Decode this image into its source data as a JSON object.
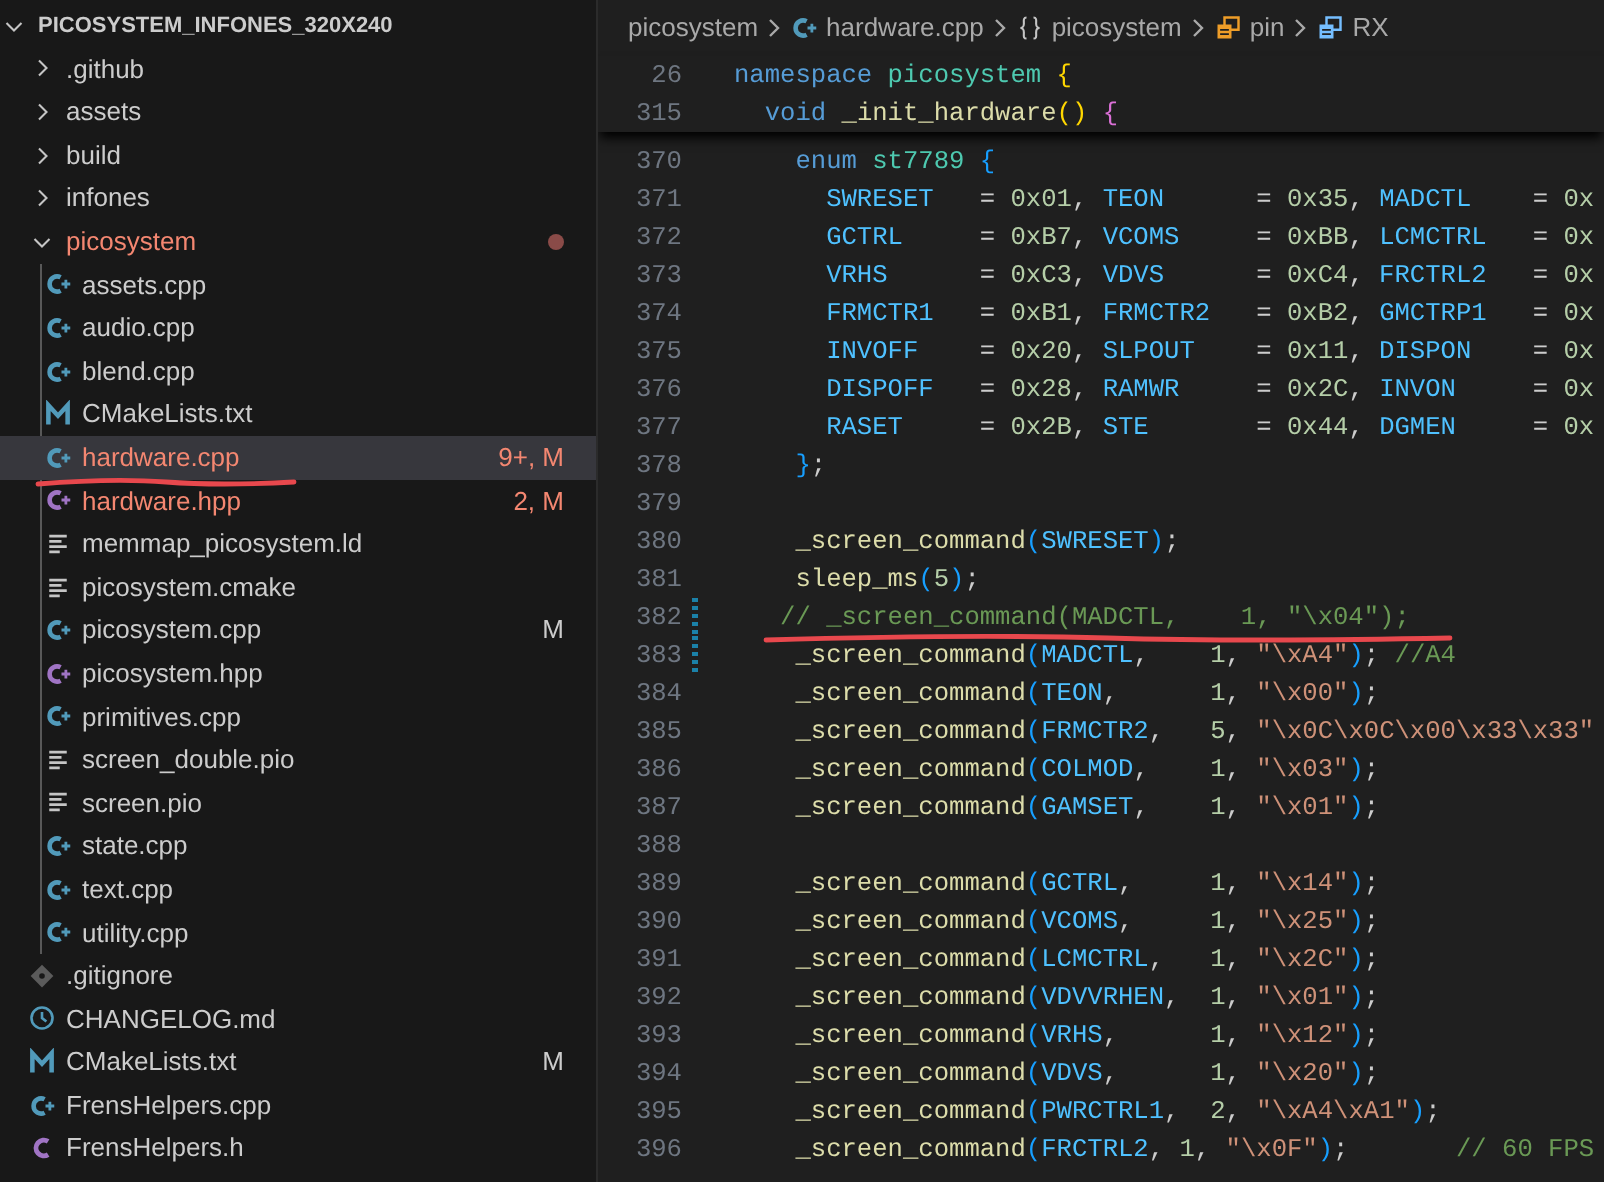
{
  "explorer": {
    "title": "PICOSYSTEM_INFONES_320X240",
    "expanded": true,
    "items": [
      {
        "label": ".github",
        "kind": "folder",
        "expanded": false,
        "selected": false,
        "error": false,
        "underlined": false
      },
      {
        "label": "assets",
        "kind": "folder",
        "expanded": false,
        "selected": false,
        "error": false,
        "underlined": false
      },
      {
        "label": "build",
        "kind": "folder",
        "expanded": false,
        "selected": false,
        "error": false,
        "underlined": false
      },
      {
        "label": "infones",
        "kind": "folder",
        "expanded": false,
        "selected": false,
        "error": false,
        "underlined": false
      },
      {
        "label": "picosystem",
        "kind": "folder",
        "expanded": true,
        "selected": false,
        "error": true,
        "underlined": false,
        "problem_dot": true,
        "children": [
          {
            "label": "assets.cpp",
            "kind": "cpp",
            "selected": false,
            "error": false,
            "underlined": false
          },
          {
            "label": "audio.cpp",
            "kind": "cpp",
            "selected": false,
            "error": false,
            "underlined": false
          },
          {
            "label": "blend.cpp",
            "kind": "cpp",
            "selected": false,
            "error": false,
            "underlined": false
          },
          {
            "label": "CMakeLists.txt",
            "kind": "cmake",
            "selected": false,
            "error": false,
            "underlined": false
          },
          {
            "label": "hardware.cpp",
            "kind": "cpp",
            "selected": true,
            "error": true,
            "underlined": true,
            "badge": "9+, M"
          },
          {
            "label": "hardware.hpp",
            "kind": "hpp",
            "selected": false,
            "error": true,
            "underlined": false,
            "badge": "2, M"
          },
          {
            "label": "memmap_picosystem.ld",
            "kind": "text",
            "selected": false,
            "error": false,
            "underlined": false
          },
          {
            "label": "picosystem.cmake",
            "kind": "text",
            "selected": false,
            "error": false,
            "underlined": false
          },
          {
            "label": "picosystem.cpp",
            "kind": "cpp",
            "selected": false,
            "error": false,
            "underlined": false,
            "badge": "M"
          },
          {
            "label": "picosystem.hpp",
            "kind": "hpp",
            "selected": false,
            "error": false,
            "underlined": false
          },
          {
            "label": "primitives.cpp",
            "kind": "cpp",
            "selected": false,
            "error": false,
            "underlined": false
          },
          {
            "label": "screen_double.pio",
            "kind": "text",
            "selected": false,
            "error": false,
            "underlined": false
          },
          {
            "label": "screen.pio",
            "kind": "text",
            "selected": false,
            "error": false,
            "underlined": false
          },
          {
            "label": "state.cpp",
            "kind": "cpp",
            "selected": false,
            "error": false,
            "underlined": false
          },
          {
            "label": "text.cpp",
            "kind": "cpp",
            "selected": false,
            "error": false,
            "underlined": false
          },
          {
            "label": "utility.cpp",
            "kind": "cpp",
            "selected": false,
            "error": false,
            "underlined": false
          }
        ]
      },
      {
        "label": ".gitignore",
        "kind": "git",
        "selected": false,
        "error": false,
        "underlined": false
      },
      {
        "label": "CHANGELOG.md",
        "kind": "changelog",
        "selected": false,
        "error": false,
        "underlined": false
      },
      {
        "label": "CMakeLists.txt",
        "kind": "cmake",
        "selected": false,
        "error": false,
        "underlined": false,
        "badge": "M"
      },
      {
        "label": "FrensHelpers.cpp",
        "kind": "cpp",
        "selected": false,
        "error": false,
        "underlined": false
      },
      {
        "label": "FrensHelpers.h",
        "kind": "h",
        "selected": false,
        "error": false,
        "underlined": false
      }
    ]
  },
  "breadcrumbs": [
    {
      "label": "picosystem",
      "kind": "path"
    },
    {
      "label": "hardware.cpp",
      "kind": "cpp"
    },
    {
      "label": "picosystem",
      "kind": "namespace"
    },
    {
      "label": "pin",
      "kind": "struct"
    },
    {
      "label": "RX",
      "kind": "field"
    }
  ],
  "sticky_lines": [
    {
      "number": "26",
      "tokens": [
        {
          "text": "namespace ",
          "kind": "kw"
        },
        {
          "text": "picosystem ",
          "kind": "ns"
        },
        {
          "text": "{",
          "kind": "b1"
        }
      ]
    },
    {
      "number": "315",
      "tokens": [
        {
          "text": "  void ",
          "kind": "kw"
        },
        {
          "text": "_init_hardware",
          "kind": "fn"
        },
        {
          "text": "()",
          "kind": "b1"
        },
        {
          "text": " {",
          "kind": "b2"
        }
      ]
    }
  ],
  "code_lines": [
    {
      "number": "370",
      "modified": false,
      "underlined": false,
      "tokens": [
        {
          "text": "    enum ",
          "kind": "kw"
        },
        {
          "text": "st7789 ",
          "kind": "type"
        },
        {
          "text": "{",
          "kind": "b3"
        }
      ]
    },
    {
      "number": "371",
      "modified": false,
      "underlined": false,
      "tokens": [
        {
          "text": "      SWRESET",
          "kind": "enum"
        },
        {
          "text": "   = ",
          "kind": "plain"
        },
        {
          "text": "0x01",
          "kind": "num"
        },
        {
          "text": ", ",
          "kind": "plain"
        },
        {
          "text": "TEON",
          "kind": "enum"
        },
        {
          "text": "      = ",
          "kind": "plain"
        },
        {
          "text": "0x35",
          "kind": "num"
        },
        {
          "text": ", ",
          "kind": "plain"
        },
        {
          "text": "MADCTL",
          "kind": "enum"
        },
        {
          "text": "    = ",
          "kind": "plain"
        },
        {
          "text": "0x",
          "kind": "num"
        }
      ]
    },
    {
      "number": "372",
      "modified": false,
      "underlined": false,
      "tokens": [
        {
          "text": "      GCTRL",
          "kind": "enum"
        },
        {
          "text": "     = ",
          "kind": "plain"
        },
        {
          "text": "0xB7",
          "kind": "num"
        },
        {
          "text": ", ",
          "kind": "plain"
        },
        {
          "text": "VCOMS",
          "kind": "enum"
        },
        {
          "text": "     = ",
          "kind": "plain"
        },
        {
          "text": "0xBB",
          "kind": "num"
        },
        {
          "text": ", ",
          "kind": "plain"
        },
        {
          "text": "LCMCTRL",
          "kind": "enum"
        },
        {
          "text": "   = ",
          "kind": "plain"
        },
        {
          "text": "0x",
          "kind": "num"
        }
      ]
    },
    {
      "number": "373",
      "modified": false,
      "underlined": false,
      "tokens": [
        {
          "text": "      VRHS",
          "kind": "enum"
        },
        {
          "text": "      = ",
          "kind": "plain"
        },
        {
          "text": "0xC3",
          "kind": "num"
        },
        {
          "text": ", ",
          "kind": "plain"
        },
        {
          "text": "VDVS",
          "kind": "enum"
        },
        {
          "text": "      = ",
          "kind": "plain"
        },
        {
          "text": "0xC4",
          "kind": "num"
        },
        {
          "text": ", ",
          "kind": "plain"
        },
        {
          "text": "FRCTRL2",
          "kind": "enum"
        },
        {
          "text": "   = ",
          "kind": "plain"
        },
        {
          "text": "0x",
          "kind": "num"
        }
      ]
    },
    {
      "number": "374",
      "modified": false,
      "underlined": false,
      "tokens": [
        {
          "text": "      FRMCTR1",
          "kind": "enum"
        },
        {
          "text": "   = ",
          "kind": "plain"
        },
        {
          "text": "0xB1",
          "kind": "num"
        },
        {
          "text": ", ",
          "kind": "plain"
        },
        {
          "text": "FRMCTR2",
          "kind": "enum"
        },
        {
          "text": "   = ",
          "kind": "plain"
        },
        {
          "text": "0xB2",
          "kind": "num"
        },
        {
          "text": ", ",
          "kind": "plain"
        },
        {
          "text": "GMCTRP1",
          "kind": "enum"
        },
        {
          "text": "   = ",
          "kind": "plain"
        },
        {
          "text": "0x",
          "kind": "num"
        }
      ]
    },
    {
      "number": "375",
      "modified": false,
      "underlined": false,
      "tokens": [
        {
          "text": "      INVOFF",
          "kind": "enum"
        },
        {
          "text": "    = ",
          "kind": "plain"
        },
        {
          "text": "0x20",
          "kind": "num"
        },
        {
          "text": ", ",
          "kind": "plain"
        },
        {
          "text": "SLPOUT",
          "kind": "enum"
        },
        {
          "text": "    = ",
          "kind": "plain"
        },
        {
          "text": "0x11",
          "kind": "num"
        },
        {
          "text": ", ",
          "kind": "plain"
        },
        {
          "text": "DISPON",
          "kind": "enum"
        },
        {
          "text": "    = ",
          "kind": "plain"
        },
        {
          "text": "0x",
          "kind": "num"
        }
      ]
    },
    {
      "number": "376",
      "modified": false,
      "underlined": false,
      "tokens": [
        {
          "text": "      DISPOFF",
          "kind": "enum"
        },
        {
          "text": "   = ",
          "kind": "plain"
        },
        {
          "text": "0x28",
          "kind": "num"
        },
        {
          "text": ", ",
          "kind": "plain"
        },
        {
          "text": "RAMWR",
          "kind": "enum"
        },
        {
          "text": "     = ",
          "kind": "plain"
        },
        {
          "text": "0x2C",
          "kind": "num"
        },
        {
          "text": ", ",
          "kind": "plain"
        },
        {
          "text": "INVON",
          "kind": "enum"
        },
        {
          "text": "     = ",
          "kind": "plain"
        },
        {
          "text": "0x",
          "kind": "num"
        }
      ]
    },
    {
      "number": "377",
      "modified": false,
      "underlined": false,
      "tokens": [
        {
          "text": "      RASET",
          "kind": "enum"
        },
        {
          "text": "     = ",
          "kind": "plain"
        },
        {
          "text": "0x2B",
          "kind": "num"
        },
        {
          "text": ", ",
          "kind": "plain"
        },
        {
          "text": "STE",
          "kind": "enum"
        },
        {
          "text": "       = ",
          "kind": "plain"
        },
        {
          "text": "0x44",
          "kind": "num"
        },
        {
          "text": ", ",
          "kind": "plain"
        },
        {
          "text": "DGMEN",
          "kind": "enum"
        },
        {
          "text": "     = ",
          "kind": "plain"
        },
        {
          "text": "0x",
          "kind": "num"
        }
      ]
    },
    {
      "number": "378",
      "modified": false,
      "underlined": false,
      "tokens": [
        {
          "text": "    }",
          "kind": "b3"
        },
        {
          "text": ";",
          "kind": "plain"
        }
      ]
    },
    {
      "number": "379",
      "modified": false,
      "underlined": false
    },
    {
      "number": "380",
      "modified": false,
      "underlined": false,
      "tokens": [
        {
          "text": "    _screen_command",
          "kind": "fn"
        },
        {
          "text": "(",
          "kind": "b3"
        },
        {
          "text": "SWRESET",
          "kind": "enum"
        },
        {
          "text": ")",
          "kind": "b3"
        },
        {
          "text": ";",
          "kind": "plain"
        }
      ]
    },
    {
      "number": "381",
      "modified": false,
      "underlined": false,
      "tokens": [
        {
          "text": "    sleep_ms",
          "kind": "fn"
        },
        {
          "text": "(",
          "kind": "b3"
        },
        {
          "text": "5",
          "kind": "num"
        },
        {
          "text": ")",
          "kind": "b3"
        },
        {
          "text": ";",
          "kind": "plain"
        }
      ]
    },
    {
      "number": "382",
      "modified": true,
      "underlined": true,
      "tokens": [
        {
          "text": "   // _screen_command(MADCTL,    1, \"\\x04\");",
          "kind": "comment"
        }
      ]
    },
    {
      "number": "383",
      "modified": true,
      "underlined": false,
      "tokens": [
        {
          "text": "    _screen_command",
          "kind": "fn"
        },
        {
          "text": "(",
          "kind": "b3"
        },
        {
          "text": "MADCTL",
          "kind": "enum"
        },
        {
          "text": ",    ",
          "kind": "plain"
        },
        {
          "text": "1",
          "kind": "num"
        },
        {
          "text": ", ",
          "kind": "plain"
        },
        {
          "text": "\"\\xA4\"",
          "kind": "str"
        },
        {
          "text": ")",
          "kind": "b3"
        },
        {
          "text": "; ",
          "kind": "plain"
        },
        {
          "text": "//A4",
          "kind": "comment"
        }
      ]
    },
    {
      "number": "384",
      "modified": false,
      "underlined": false,
      "tokens": [
        {
          "text": "    _screen_command",
          "kind": "fn"
        },
        {
          "text": "(",
          "kind": "b3"
        },
        {
          "text": "TEON",
          "kind": "enum"
        },
        {
          "text": ",      ",
          "kind": "plain"
        },
        {
          "text": "1",
          "kind": "num"
        },
        {
          "text": ", ",
          "kind": "plain"
        },
        {
          "text": "\"\\x00\"",
          "kind": "str"
        },
        {
          "text": ")",
          "kind": "b3"
        },
        {
          "text": ";",
          "kind": "plain"
        }
      ]
    },
    {
      "number": "385",
      "modified": false,
      "underlined": false,
      "tokens": [
        {
          "text": "    _screen_command",
          "kind": "fn"
        },
        {
          "text": "(",
          "kind": "b3"
        },
        {
          "text": "FRMCTR2",
          "kind": "enum"
        },
        {
          "text": ",   ",
          "kind": "plain"
        },
        {
          "text": "5",
          "kind": "num"
        },
        {
          "text": ", ",
          "kind": "plain"
        },
        {
          "text": "\"\\x0C\\x0C\\x00\\x33\\x33\"",
          "kind": "str"
        }
      ]
    },
    {
      "number": "386",
      "modified": false,
      "underlined": false,
      "tokens": [
        {
          "text": "    _screen_command",
          "kind": "fn"
        },
        {
          "text": "(",
          "kind": "b3"
        },
        {
          "text": "COLMOD",
          "kind": "enum"
        },
        {
          "text": ",    ",
          "kind": "plain"
        },
        {
          "text": "1",
          "kind": "num"
        },
        {
          "text": ", ",
          "kind": "plain"
        },
        {
          "text": "\"\\x03\"",
          "kind": "str"
        },
        {
          "text": ")",
          "kind": "b3"
        },
        {
          "text": ";",
          "kind": "plain"
        }
      ]
    },
    {
      "number": "387",
      "modified": false,
      "underlined": false,
      "tokens": [
        {
          "text": "    _screen_command",
          "kind": "fn"
        },
        {
          "text": "(",
          "kind": "b3"
        },
        {
          "text": "GAMSET",
          "kind": "enum"
        },
        {
          "text": ",    ",
          "kind": "plain"
        },
        {
          "text": "1",
          "kind": "num"
        },
        {
          "text": ", ",
          "kind": "plain"
        },
        {
          "text": "\"\\x01\"",
          "kind": "str"
        },
        {
          "text": ")",
          "kind": "b3"
        },
        {
          "text": ";",
          "kind": "plain"
        }
      ]
    },
    {
      "number": "388",
      "modified": false,
      "underlined": false
    },
    {
      "number": "389",
      "modified": false,
      "underlined": false,
      "tokens": [
        {
          "text": "    _screen_command",
          "kind": "fn"
        },
        {
          "text": "(",
          "kind": "b3"
        },
        {
          "text": "GCTRL",
          "kind": "enum"
        },
        {
          "text": ",     ",
          "kind": "plain"
        },
        {
          "text": "1",
          "kind": "num"
        },
        {
          "text": ", ",
          "kind": "plain"
        },
        {
          "text": "\"\\x14\"",
          "kind": "str"
        },
        {
          "text": ")",
          "kind": "b3"
        },
        {
          "text": ";",
          "kind": "plain"
        }
      ]
    },
    {
      "number": "390",
      "modified": false,
      "underlined": false,
      "tokens": [
        {
          "text": "    _screen_command",
          "kind": "fn"
        },
        {
          "text": "(",
          "kind": "b3"
        },
        {
          "text": "VCOMS",
          "kind": "enum"
        },
        {
          "text": ",     ",
          "kind": "plain"
        },
        {
          "text": "1",
          "kind": "num"
        },
        {
          "text": ", ",
          "kind": "plain"
        },
        {
          "text": "\"\\x25\"",
          "kind": "str"
        },
        {
          "text": ")",
          "kind": "b3"
        },
        {
          "text": ";",
          "kind": "plain"
        }
      ]
    },
    {
      "number": "391",
      "modified": false,
      "underlined": false,
      "tokens": [
        {
          "text": "    _screen_command",
          "kind": "fn"
        },
        {
          "text": "(",
          "kind": "b3"
        },
        {
          "text": "LCMCTRL",
          "kind": "enum"
        },
        {
          "text": ",   ",
          "kind": "plain"
        },
        {
          "text": "1",
          "kind": "num"
        },
        {
          "text": ", ",
          "kind": "plain"
        },
        {
          "text": "\"\\x2C\"",
          "kind": "str"
        },
        {
          "text": ")",
          "kind": "b3"
        },
        {
          "text": ";",
          "kind": "plain"
        }
      ]
    },
    {
      "number": "392",
      "modified": false,
      "underlined": false,
      "tokens": [
        {
          "text": "    _screen_command",
          "kind": "fn"
        },
        {
          "text": "(",
          "kind": "b3"
        },
        {
          "text": "VDVVRHEN",
          "kind": "enum"
        },
        {
          "text": ",  ",
          "kind": "plain"
        },
        {
          "text": "1",
          "kind": "num"
        },
        {
          "text": ", ",
          "kind": "plain"
        },
        {
          "text": "\"\\x01\"",
          "kind": "str"
        },
        {
          "text": ")",
          "kind": "b3"
        },
        {
          "text": ";",
          "kind": "plain"
        }
      ]
    },
    {
      "number": "393",
      "modified": false,
      "underlined": false,
      "tokens": [
        {
          "text": "    _screen_command",
          "kind": "fn"
        },
        {
          "text": "(",
          "kind": "b3"
        },
        {
          "text": "VRHS",
          "kind": "enum"
        },
        {
          "text": ",      ",
          "kind": "plain"
        },
        {
          "text": "1",
          "kind": "num"
        },
        {
          "text": ", ",
          "kind": "plain"
        },
        {
          "text": "\"\\x12\"",
          "kind": "str"
        },
        {
          "text": ")",
          "kind": "b3"
        },
        {
          "text": ";",
          "kind": "plain"
        }
      ]
    },
    {
      "number": "394",
      "modified": false,
      "underlined": false,
      "tokens": [
        {
          "text": "    _screen_command",
          "kind": "fn"
        },
        {
          "text": "(",
          "kind": "b3"
        },
        {
          "text": "VDVS",
          "kind": "enum"
        },
        {
          "text": ",      ",
          "kind": "plain"
        },
        {
          "text": "1",
          "kind": "num"
        },
        {
          "text": ", ",
          "kind": "plain"
        },
        {
          "text": "\"\\x20\"",
          "kind": "str"
        },
        {
          "text": ")",
          "kind": "b3"
        },
        {
          "text": ";",
          "kind": "plain"
        }
      ]
    },
    {
      "number": "395",
      "modified": false,
      "underlined": false,
      "tokens": [
        {
          "text": "    _screen_command",
          "kind": "fn"
        },
        {
          "text": "(",
          "kind": "b3"
        },
        {
          "text": "PWRCTRL1",
          "kind": "enum"
        },
        {
          "text": ",  ",
          "kind": "plain"
        },
        {
          "text": "2",
          "kind": "num"
        },
        {
          "text": ", ",
          "kind": "plain"
        },
        {
          "text": "\"\\xA4\\xA1\"",
          "kind": "str"
        },
        {
          "text": ")",
          "kind": "b3"
        },
        {
          "text": ";",
          "kind": "plain"
        }
      ]
    },
    {
      "number": "396",
      "modified": false,
      "underlined": false,
      "tokens": [
        {
          "text": "    _screen_command",
          "kind": "fn"
        },
        {
          "text": "(",
          "kind": "b3"
        },
        {
          "text": "FRCTRL2",
          "kind": "enum"
        },
        {
          "text": ", ",
          "kind": "plain"
        },
        {
          "text": "1",
          "kind": "num"
        },
        {
          "text": ", ",
          "kind": "plain"
        },
        {
          "text": "\"\\x0F\"",
          "kind": "str"
        },
        {
          "text": ")",
          "kind": "b3"
        },
        {
          "text": ";       ",
          "kind": "plain"
        },
        {
          "text": "// 60 FPS",
          "kind": "comment"
        }
      ]
    }
  ]
}
